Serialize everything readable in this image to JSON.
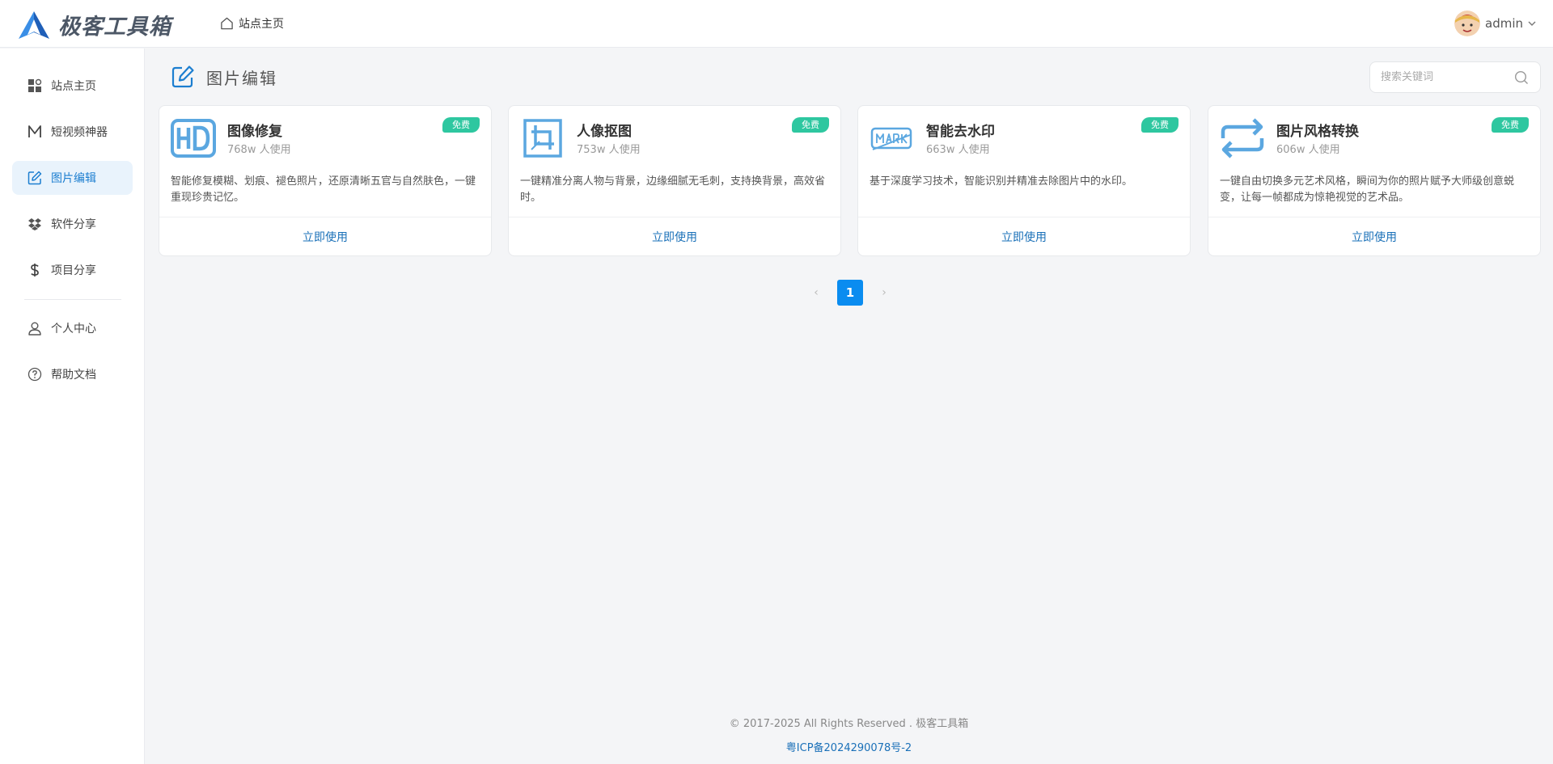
{
  "header": {
    "logo_text": "极客工具箱",
    "home_link": "站点主页",
    "username": "admin"
  },
  "sidebar": {
    "items": [
      {
        "label": "站点主页",
        "icon": "dashboard-icon"
      },
      {
        "label": "短视频神器",
        "icon": "m-letter-icon"
      },
      {
        "label": "图片编辑",
        "icon": "edit-icon",
        "active": true
      },
      {
        "label": "软件分享",
        "icon": "dropbox-icon"
      },
      {
        "label": "项目分享",
        "icon": "dollar-icon"
      },
      {
        "label": "个人中心",
        "icon": "user-icon"
      },
      {
        "label": "帮助文档",
        "icon": "help-icon"
      }
    ]
  },
  "main": {
    "title": "图片编辑",
    "search_placeholder": "搜索关键词",
    "cards": [
      {
        "title": "图像修复",
        "users": "768w 人使用",
        "badge": "免费",
        "desc": "智能修复模糊、划痕、褪色照片，还原清晰五官与自然肤色，一键重现珍贵记忆。",
        "action": "立即使用",
        "icon": "hd-icon"
      },
      {
        "title": "人像抠图",
        "users": "753w 人使用",
        "badge": "免费",
        "desc": "一键精准分离人物与背景，边缘细腻无毛刺，支持换背景，高效省时。",
        "action": "立即使用",
        "icon": "crop-icon"
      },
      {
        "title": "智能去水印",
        "users": "663w 人使用",
        "badge": "免费",
        "desc": "基于深度学习技术，智能识别并精准去除图片中的水印。",
        "action": "立即使用",
        "icon": "watermark-icon"
      },
      {
        "title": "图片风格转换",
        "users": "606w 人使用",
        "badge": "免费",
        "desc": "一键自由切换多元艺术风格，瞬间为你的照片赋予大师级创意蜕变，让每一帧都成为惊艳视觉的艺术品。",
        "action": "立即使用",
        "icon": "repeat-icon"
      }
    ],
    "pagination": {
      "current": "1",
      "prev": "‹",
      "next": "›"
    }
  },
  "footer": {
    "copyright": "© 2017-2025 All Rights Reserved . 极客工具箱",
    "icp": "粤ICP备2024290078号-2"
  },
  "colors": {
    "accent": "#0a8cf0",
    "badge": "#2ec7a0",
    "link": "#1a70b8",
    "icon_blue": "#5ba7e0"
  }
}
